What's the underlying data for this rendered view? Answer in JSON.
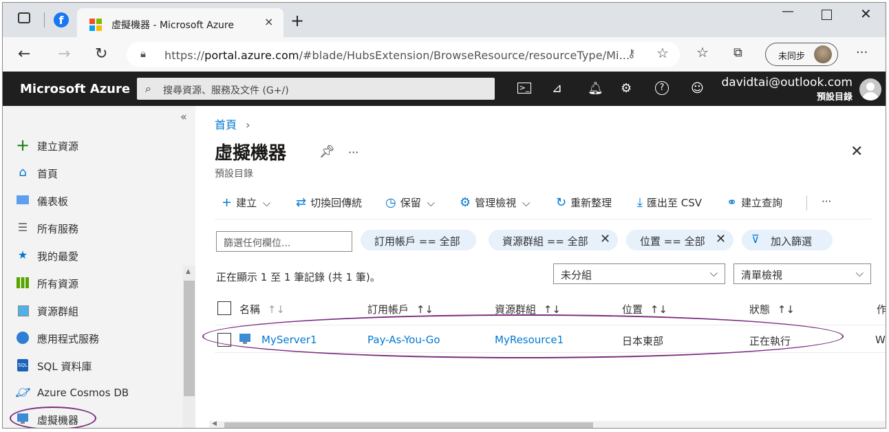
{
  "browser": {
    "tab_title": "虛擬機器 - Microsoft Azure",
    "tab_close": "×",
    "new_tab": "+",
    "url_scheme": "https://",
    "url_host": "portal.azure.com",
    "url_path": "/#blade/HubsExtension/BrowseResource/resourceType/Mi...",
    "sync_label": "未同步",
    "more": "···"
  },
  "azure_header": {
    "brand": "Microsoft Azure",
    "search_placeholder": "搜尋資源、服務及文件 (G+/)",
    "user_email": "davidtai@outlook.com",
    "user_directory": "預設目錄"
  },
  "sidebar": {
    "collapse": "«",
    "items": [
      {
        "label": "建立資源",
        "icon": "plus-icon"
      },
      {
        "label": "首頁",
        "icon": "home-icon"
      },
      {
        "label": "儀表板",
        "icon": "dashboard-icon"
      },
      {
        "label": "所有服務",
        "icon": "list-icon"
      },
      {
        "label": "我的最愛",
        "icon": "star-icon"
      },
      {
        "label": "所有資源",
        "icon": "grid-icon"
      },
      {
        "label": "資源群組",
        "icon": "resource-group-icon"
      },
      {
        "label": "應用程式服務",
        "icon": "app-service-icon"
      },
      {
        "label": "SQL 資料庫",
        "icon": "sql-icon"
      },
      {
        "label": "Azure Cosmos DB",
        "icon": "cosmos-icon"
      },
      {
        "label": "虛擬機器",
        "icon": "vm-icon"
      }
    ]
  },
  "main": {
    "breadcrumb_home": "首頁",
    "breadcrumb_sep": "›",
    "title": "虛擬機器",
    "subtitle": "預設目錄",
    "more": "···",
    "toolbar": {
      "create": "建立",
      "switch_classic": "切換回傳統",
      "reservations": "保留",
      "manage_view": "管理檢視",
      "refresh": "重新整理",
      "export_csv": "匯出至 CSV",
      "open_query": "建立查詢",
      "more": "···"
    },
    "filter_placeholder": "篩選任何欄位...",
    "filters": [
      "訂用帳戶 == 全部",
      "資源群組 == 全部",
      "位置 == 全部"
    ],
    "add_filter": "加入篩選",
    "record_count": "正在顯示 1 至 1 筆記錄 (共 1 筆)。",
    "grouping": "未分組",
    "view_mode": "清單檢視",
    "columns": [
      "名稱",
      "訂用帳戶",
      "資源群組",
      "位置",
      "狀態",
      "作"
    ],
    "rows": [
      {
        "name": "MyServer1",
        "subscription": "Pay-As-You-Go",
        "resource_group": "MyResource1",
        "location": "日本東部",
        "status": "正在執行",
        "extra": "Wi"
      }
    ]
  },
  "colors": {
    "accent": "#0078d4",
    "header_bg": "#1f1f1f",
    "annotation": "#7b2a7f"
  }
}
